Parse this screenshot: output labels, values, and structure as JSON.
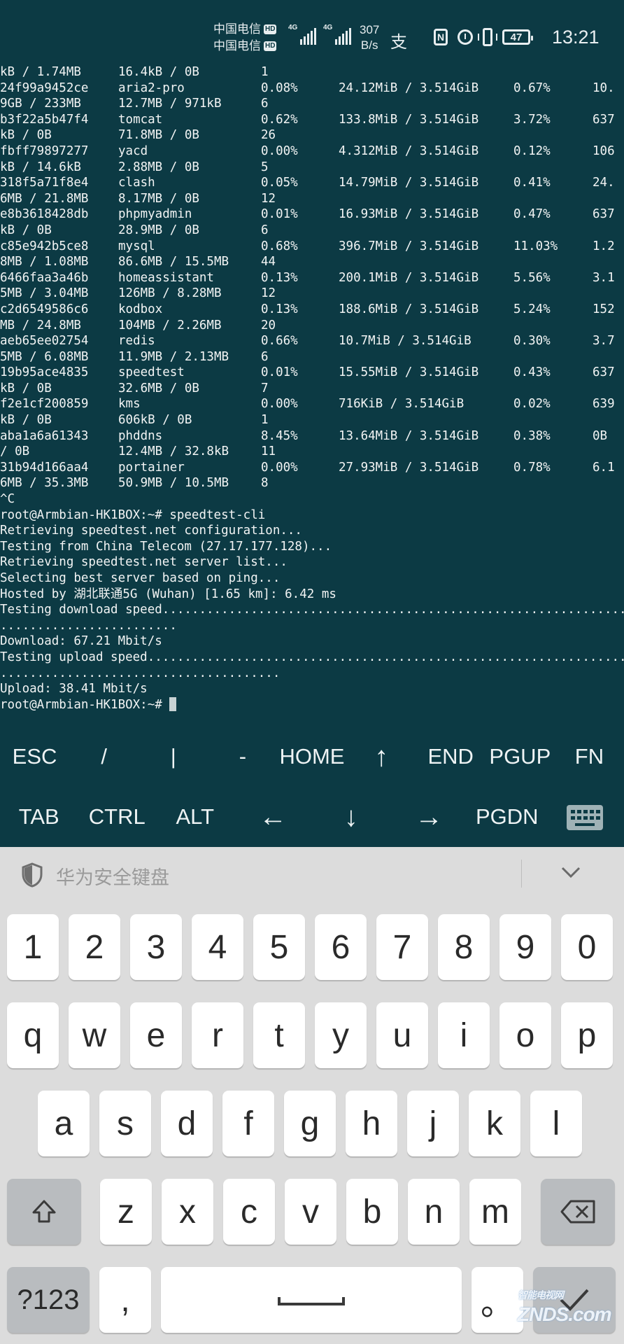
{
  "status_bar": {
    "carrier1": "中国电信",
    "carrier2": "中国电信",
    "hd": "HD",
    "net_type": "4G",
    "speed_value": "307",
    "speed_unit": "B/s",
    "pay_icon": "alipay-icon",
    "battery": "47",
    "time": "13:21"
  },
  "terminal": {
    "stats_rows": [
      {
        "a": "kB / 1.74MB",
        "b": "16.4kB / 0B",
        "c": "1",
        "d": "",
        "e": "",
        "f": "",
        "g": ""
      },
      {
        "a": "24f99a9452ce",
        "b": "aria2-pro",
        "c": "0.08%",
        "d": "",
        "e": "24.12MiB / 3.514GiB",
        "f": "0.67%",
        "g": "10."
      },
      {
        "a": "9GB / 233MB",
        "b": "12.7MB / 971kB",
        "c": "6",
        "d": "",
        "e": "",
        "f": "",
        "g": ""
      },
      {
        "a": "b3f22a5b47f4",
        "b": "tomcat",
        "c": "0.62%",
        "d": "",
        "e": "133.8MiB / 3.514GiB",
        "f": "3.72%",
        "g": "637"
      },
      {
        "a": "kB / 0B",
        "b": "71.8MB / 0B",
        "c": "26",
        "d": "",
        "e": "",
        "f": "",
        "g": ""
      },
      {
        "a": "fbff79897277",
        "b": "yacd",
        "c": "0.00%",
        "d": "",
        "e": "4.312MiB / 3.514GiB",
        "f": "0.12%",
        "g": "106"
      },
      {
        "a": "kB / 14.6kB",
        "b": "2.88MB / 0B",
        "c": "5",
        "d": "",
        "e": "",
        "f": "",
        "g": ""
      },
      {
        "a": "318f5a71f8e4",
        "b": "clash",
        "c": "0.05%",
        "d": "",
        "e": "14.79MiB / 3.514GiB",
        "f": "0.41%",
        "g": "24."
      },
      {
        "a": "6MB / 21.8MB",
        "b": "8.17MB / 0B",
        "c": "12",
        "d": "",
        "e": "",
        "f": "",
        "g": ""
      },
      {
        "a": "e8b3618428db",
        "b": "phpmyadmin",
        "c": "0.01%",
        "d": "",
        "e": "16.93MiB / 3.514GiB",
        "f": "0.47%",
        "g": "637"
      },
      {
        "a": "kB / 0B",
        "b": "28.9MB / 0B",
        "c": "6",
        "d": "",
        "e": "",
        "f": "",
        "g": ""
      },
      {
        "a": "c85e942b5ce8",
        "b": "mysql",
        "c": "0.68%",
        "d": "",
        "e": "396.7MiB / 3.514GiB",
        "f": "11.03%",
        "g": "1.2"
      },
      {
        "a": "8MB / 1.08MB",
        "b": "86.6MB / 15.5MB",
        "c": "44",
        "d": "",
        "e": "",
        "f": "",
        "g": ""
      },
      {
        "a": "6466faa3a46b",
        "b": "homeassistant",
        "c": "0.13%",
        "d": "",
        "e": "200.1MiB / 3.514GiB",
        "f": "5.56%",
        "g": "3.1"
      },
      {
        "a": "5MB / 3.04MB",
        "b": "126MB / 8.28MB",
        "c": "12",
        "d": "",
        "e": "",
        "f": "",
        "g": ""
      },
      {
        "a": "c2d6549586c6",
        "b": "kodbox",
        "c": "0.13%",
        "d": "",
        "e": "188.6MiB / 3.514GiB",
        "f": "5.24%",
        "g": "152"
      },
      {
        "a": "MB / 24.8MB",
        "b": "104MB / 2.26MB",
        "c": "20",
        "d": "",
        "e": "",
        "f": "",
        "g": ""
      },
      {
        "a": "aeb65ee02754",
        "b": "redis",
        "c": "0.66%",
        "d": "",
        "e": "10.7MiB / 3.514GiB",
        "f": "0.30%",
        "g": "3.7"
      },
      {
        "a": "5MB / 6.08MB",
        "b": "11.9MB / 2.13MB",
        "c": "6",
        "d": "",
        "e": "",
        "f": "",
        "g": ""
      },
      {
        "a": "19b95ace4835",
        "b": "speedtest",
        "c": "0.01%",
        "d": "",
        "e": "15.55MiB / 3.514GiB",
        "f": "0.43%",
        "g": "637"
      },
      {
        "a": "kB / 0B",
        "b": "32.6MB / 0B",
        "c": "7",
        "d": "",
        "e": "",
        "f": "",
        "g": ""
      },
      {
        "a": "f2e1cf200859",
        "b": "kms",
        "c": "0.00%",
        "d": "",
        "e": "716KiB / 3.514GiB",
        "f": "0.02%",
        "g": "639"
      },
      {
        "a": "kB / 0B",
        "b": "606kB / 0B",
        "c": "1",
        "d": "",
        "e": "",
        "f": "",
        "g": ""
      },
      {
        "a": "aba1a6a61343",
        "b": "phddns",
        "c": "8.45%",
        "d": "",
        "e": "13.64MiB / 3.514GiB",
        "f": "0.38%",
        "g": "0B"
      },
      {
        "a": "/ 0B",
        "b": "12.4MB / 32.8kB",
        "c": "11",
        "d": "",
        "e": "",
        "f": "",
        "g": ""
      },
      {
        "a": "31b94d166aa4",
        "b": "portainer",
        "c": "0.00%",
        "d": "",
        "e": "27.93MiB / 3.514GiB",
        "f": "0.78%",
        "g": "6.1"
      },
      {
        "a": "6MB / 35.3MB",
        "b": "50.9MB / 10.5MB",
        "c": "8",
        "d": "",
        "e": "",
        "f": "",
        "g": ""
      }
    ],
    "log_lines": [
      "^C",
      "root@Armbian-HK1BOX:~# speedtest-cli",
      "Retrieving speedtest.net configuration...",
      "Testing from China Telecom (27.17.177.128)...",
      "Retrieving speedtest.net server list...",
      "Selecting best server based on ping...",
      "Hosted by 湖北联通5G (Wuhan) [1.65 km]: 6.42 ms",
      "Testing download speed................................................................................",
      "........................",
      "Download: 67.21 Mbit/s",
      "Testing upload speed......................................................................................",
      "......................................",
      "Upload: 38.41 Mbit/s",
      "root@Armbian-HK1BOX:~# "
    ]
  },
  "extra_keys": {
    "row1": [
      "ESC",
      "/",
      "|",
      "-",
      "HOME",
      "↑",
      "END",
      "PGUP",
      "FN"
    ],
    "row2": [
      "TAB",
      "CTRL",
      "ALT",
      "←",
      "↓",
      "→",
      "PGDN"
    ]
  },
  "keyboard": {
    "title": "华为安全键盘",
    "numbers": [
      "1",
      "2",
      "3",
      "4",
      "5",
      "6",
      "7",
      "8",
      "9",
      "0"
    ],
    "row1": [
      "q",
      "w",
      "e",
      "r",
      "t",
      "y",
      "u",
      "i",
      "o",
      "p"
    ],
    "row2": [
      "a",
      "s",
      "d",
      "f",
      "g",
      "h",
      "j",
      "k",
      "l"
    ],
    "row3": [
      "z",
      "x",
      "c",
      "v",
      "b",
      "n",
      "m"
    ],
    "symbols_label": "?123",
    "comma": ",",
    "period": "。",
    "watermark": "智能电视网",
    "watermark_brand": "ZNDS.com"
  }
}
